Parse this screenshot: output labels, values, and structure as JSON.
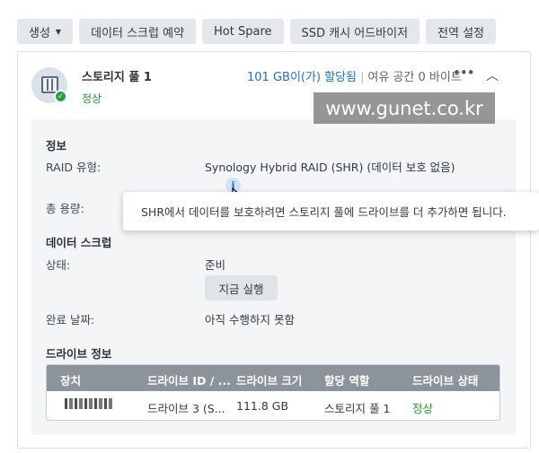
{
  "toolbar": {
    "create_label": "생성",
    "scrub_schedule_label": "데이터 스크럽 예약",
    "hot_spare_label": "Hot Spare",
    "ssd_advisor_label": "SSD 캐시 어드바이저",
    "global_settings_label": "전역 설정"
  },
  "pool": {
    "name": "스토리지 풀 1",
    "status": "정상",
    "allocated": "101 GB이(가) 할당됨",
    "separator": "|",
    "free_space": "여유 공간 0 바이트",
    "more_icon": "ellipsis-icon",
    "collapse_icon": "chevron-up-icon"
  },
  "watermark": "www.gunet.co.kr",
  "info": {
    "section_title": "정보",
    "raid_label": "RAID 유형:",
    "raid_value": "Synology Hybrid RAID (SHR) (데이터 보호 없음)",
    "capacity_label": "총 용량:"
  },
  "scrub": {
    "section_title": "데이터 스크럽",
    "status_label": "상태:",
    "status_value": "준비",
    "run_now_label": "지금 실행",
    "completed_label": "완료 날짜:",
    "completed_value": "아직 수행하지 못함"
  },
  "drives": {
    "section_title": "드라이브 정보",
    "headers": [
      "장치",
      "드라이브 ID / ...",
      "드라이브 크기",
      "할당 역할",
      "드라이브 상태"
    ],
    "rows": [
      {
        "drive_id": "드라이브 3 (S...",
        "size": "111.8 GB",
        "role": "스토리지 풀 1",
        "status": "정상"
      }
    ]
  },
  "tooltip": "SHR에서 데이터를 보호하려면 스토리지 풀에 드라이브를 더 추가하면 됩니다.",
  "colors": {
    "accent_blue": "#1a73c8",
    "status_green": "#1e9d2f",
    "table_header": "#8c939b"
  }
}
